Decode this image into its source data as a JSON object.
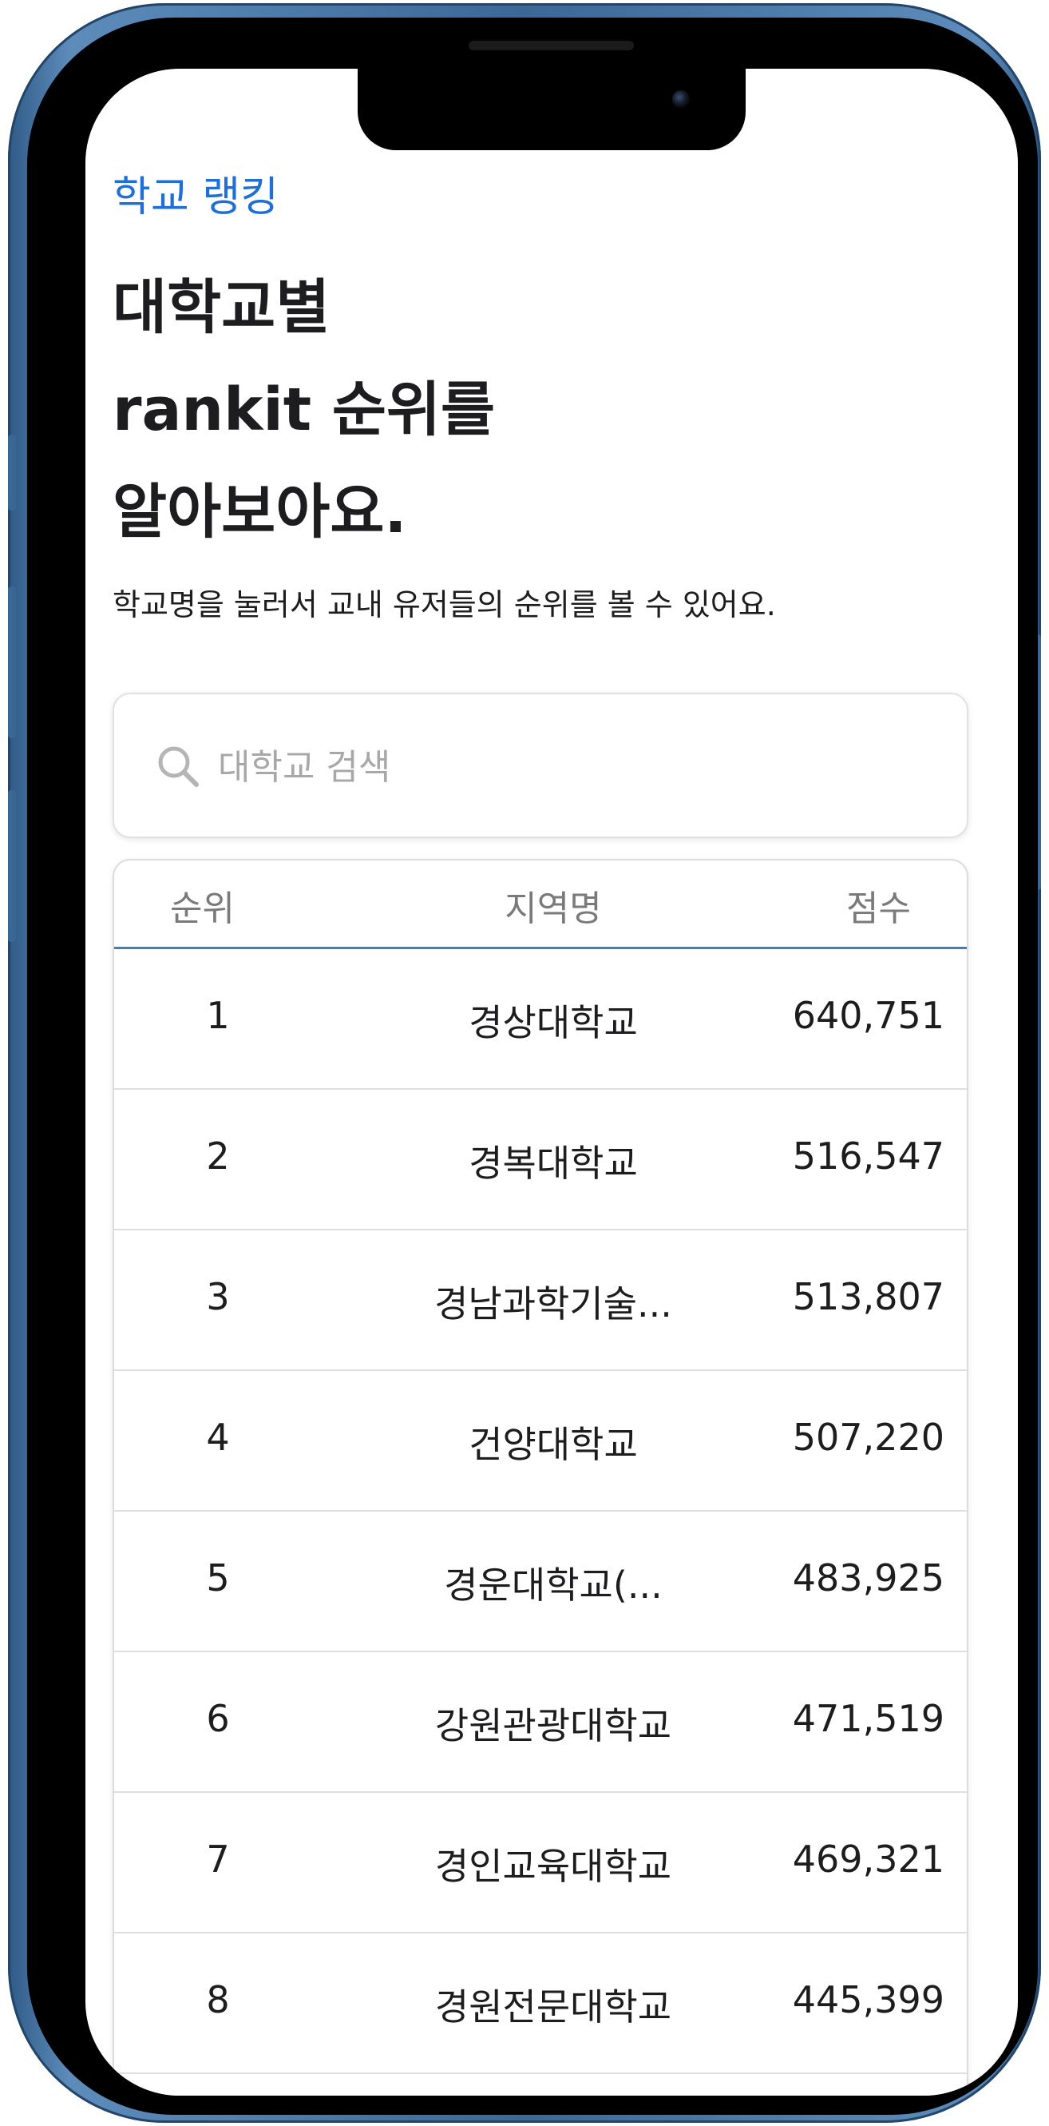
{
  "header": {
    "breadcrumb": "학교 랭킹",
    "title_lines": [
      "대학교별",
      "rankit 순위를",
      "알아보아요."
    ],
    "description": "학교명을 눌러서 교내 유저들의 순위를 볼 수 있어요."
  },
  "search": {
    "placeholder": "대학교 검색",
    "value": "",
    "icon": "search-icon"
  },
  "table": {
    "columns": [
      "순위",
      "지역명",
      "점수"
    ],
    "rows": [
      {
        "rank": "1",
        "name": "경상대학교",
        "score": "640,751"
      },
      {
        "rank": "2",
        "name": "경복대학교",
        "score": "516,547"
      },
      {
        "rank": "3",
        "name": "경남과학기술...",
        "score": "513,807"
      },
      {
        "rank": "4",
        "name": "건양대학교",
        "score": "507,220"
      },
      {
        "rank": "5",
        "name": "경운대학교(...",
        "score": "483,925"
      },
      {
        "rank": "6",
        "name": "강원관광대학교",
        "score": "471,519"
      },
      {
        "rank": "7",
        "name": "경인교육대학교",
        "score": "469,321"
      },
      {
        "rank": "8",
        "name": "경원전문대학교",
        "score": "445,399"
      }
    ]
  },
  "colors": {
    "accent": "#1f6fd6",
    "header_underline": "#3c7ec0",
    "frame": "#3b6896",
    "text": "#1d1d1f",
    "muted": "#7a7a7a"
  }
}
